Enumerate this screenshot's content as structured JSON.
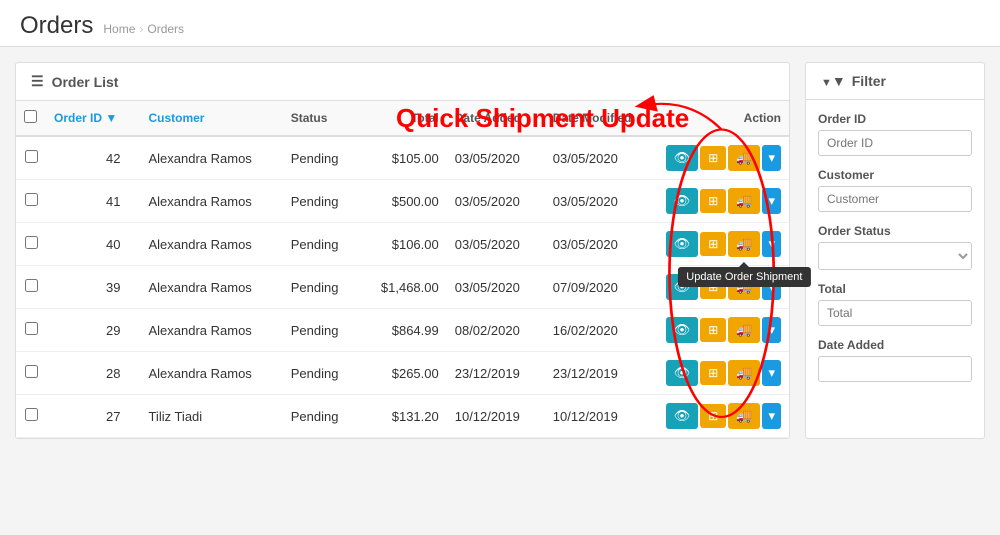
{
  "header": {
    "title": "Orders",
    "breadcrumb": [
      "Home",
      "Orders"
    ]
  },
  "quickShipmentLabel": "Quick Shipment Update",
  "orderList": {
    "panelTitle": "Order List",
    "columns": [
      {
        "key": "order_id",
        "label": "Order ID",
        "sortable": true
      },
      {
        "key": "customer",
        "label": "Customer",
        "sortable": false,
        "colored": true
      },
      {
        "key": "status",
        "label": "Status",
        "sortable": false
      },
      {
        "key": "total",
        "label": "Total",
        "sortable": false,
        "align": "right"
      },
      {
        "key": "date_added",
        "label": "Date Added",
        "sortable": false
      },
      {
        "key": "date_modified",
        "label": "Date Modified",
        "sortable": false
      },
      {
        "key": "action",
        "label": "Action",
        "sortable": false,
        "align": "right"
      }
    ],
    "rows": [
      {
        "order_id": "42",
        "customer": "Alexandra Ramos",
        "status": "Pending",
        "total": "$105.00",
        "date_added": "03/05/2020",
        "date_modified": "03/05/2020"
      },
      {
        "order_id": "41",
        "customer": "Alexandra Ramos",
        "status": "Pending",
        "total": "$500.00",
        "date_added": "03/05/2020",
        "date_modified": "03/05/2020"
      },
      {
        "order_id": "40",
        "customer": "Alexandra Ramos",
        "status": "Pending",
        "total": "$106.00",
        "date_added": "03/05/2020",
        "date_modified": "03/05/2020",
        "showTooltip": true
      },
      {
        "order_id": "39",
        "customer": "Alexandra Ramos",
        "status": "Pending",
        "total": "$1,468.00",
        "date_added": "03/05/2020",
        "date_modified": "07/09/2020"
      },
      {
        "order_id": "29",
        "customer": "Alexandra Ramos",
        "status": "Pending",
        "total": "$864.99",
        "date_added": "08/02/2020",
        "date_modified": "16/02/2020"
      },
      {
        "order_id": "28",
        "customer": "Alexandra Ramos",
        "status": "Pending",
        "total": "$265.00",
        "date_added": "23/12/2019",
        "date_modified": "23/12/2019"
      },
      {
        "order_id": "27",
        "customer": "Tiliz Tiadi",
        "status": "Pending",
        "total": "$131.20",
        "date_added": "10/12/2019",
        "date_modified": "10/12/2019"
      }
    ],
    "tooltipText": "Update Order Shipment"
  },
  "filter": {
    "panelTitle": "Filter",
    "fields": [
      {
        "label": "Order ID",
        "placeholder": "Order ID",
        "type": "text"
      },
      {
        "label": "Customer",
        "placeholder": "Customer",
        "type": "text"
      },
      {
        "label": "Order Status",
        "placeholder": "",
        "type": "select"
      },
      {
        "label": "Total",
        "placeholder": "Total",
        "type": "text"
      },
      {
        "label": "Date Added",
        "placeholder": "",
        "type": "text"
      }
    ]
  },
  "colors": {
    "btnInfo": "#17a2b8",
    "btnWarning": "#f0a500",
    "btnPrimary": "#1a9ae1",
    "columnColor": "#1a9ae1",
    "tooltipBg": "#333"
  }
}
